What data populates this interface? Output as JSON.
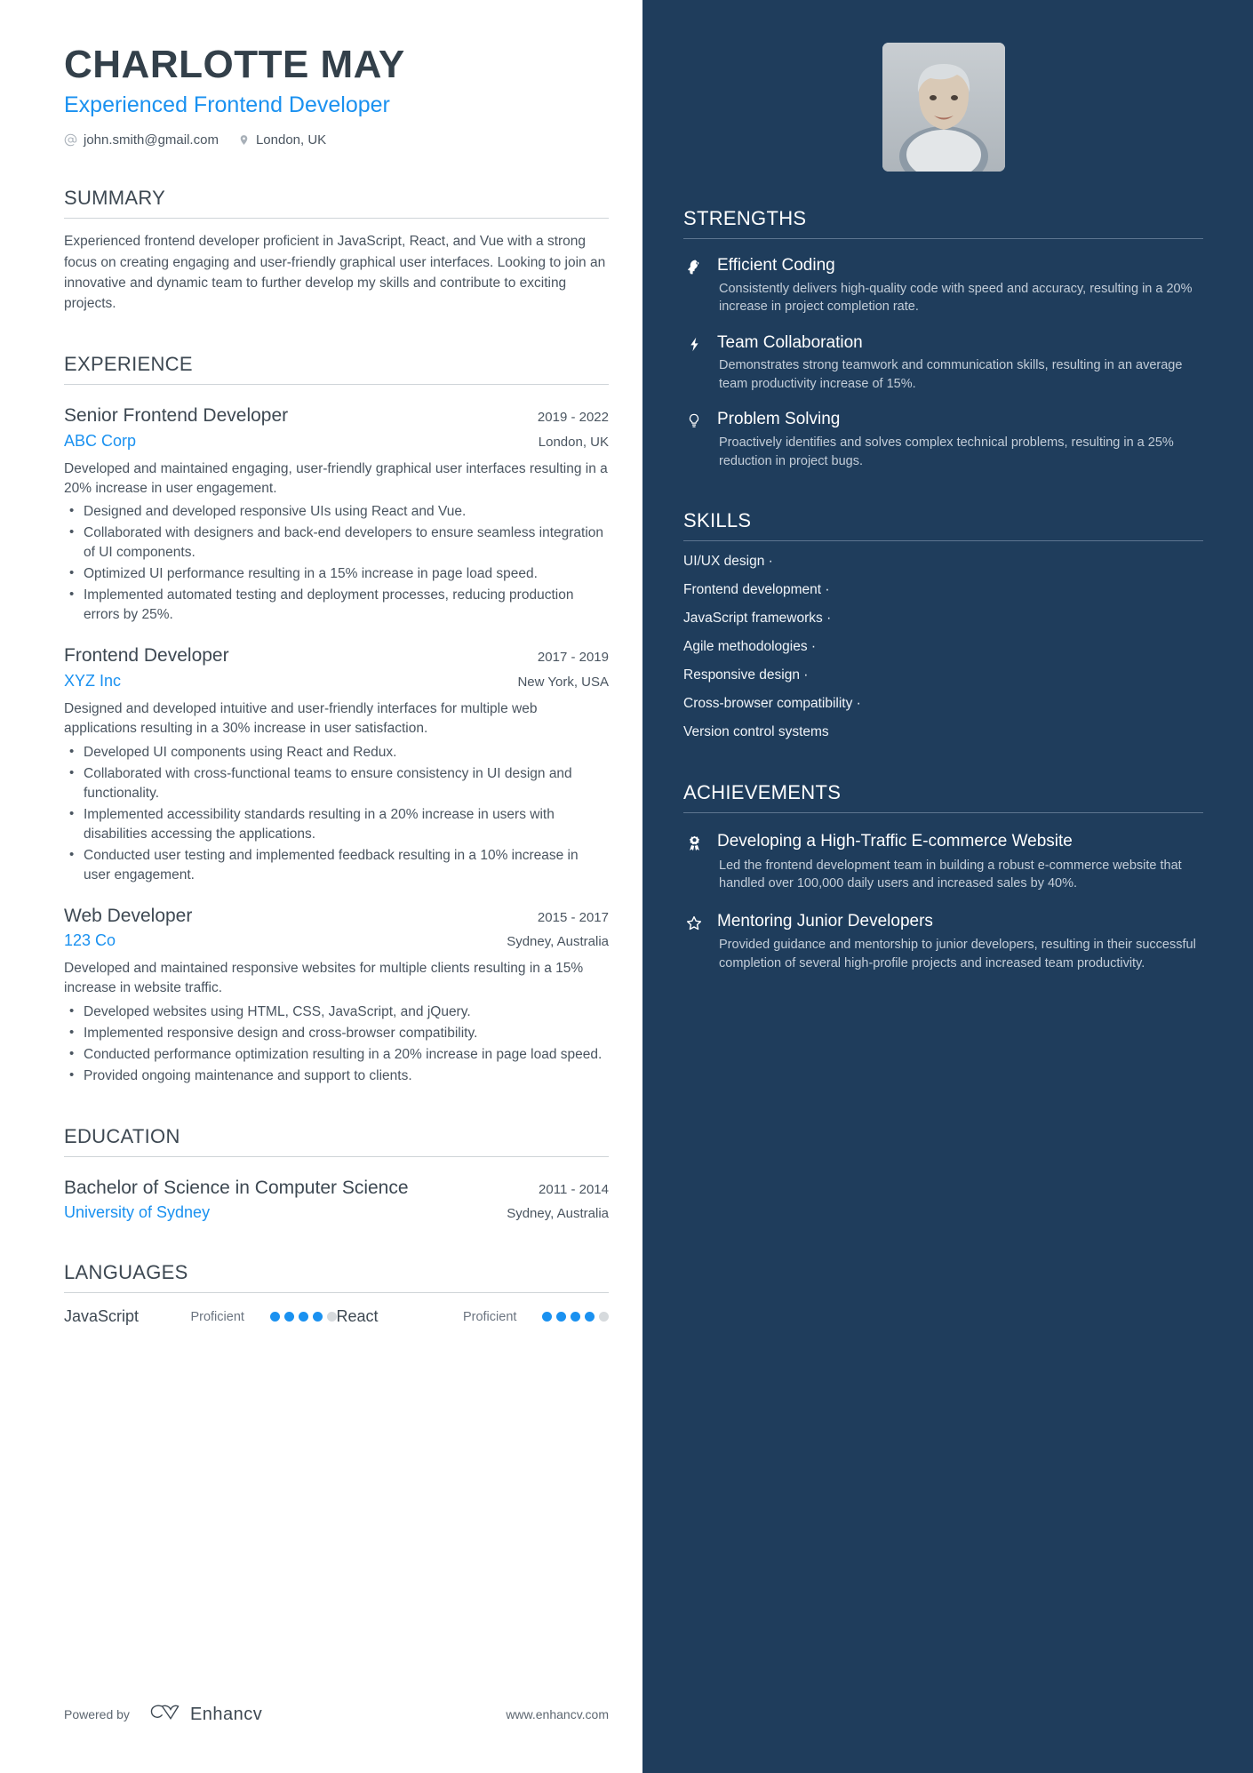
{
  "header": {
    "name": "CHARLOTTE MAY",
    "role": "Experienced Frontend Developer",
    "email": "john.smith@gmail.com",
    "location": "London, UK",
    "email_icon": "at-icon",
    "location_icon": "map-pin-icon"
  },
  "summary": {
    "title": "SUMMARY",
    "text": "Experienced frontend developer proficient in JavaScript, React, and Vue with a strong focus on creating engaging and user-friendly graphical user interfaces. Looking to join an innovative and dynamic team to further develop my skills and contribute to exciting projects."
  },
  "experience": {
    "title": "EXPERIENCE",
    "jobs": [
      {
        "title": "Senior Frontend Developer",
        "date": "2019 - 2022",
        "company": "ABC Corp",
        "location": "London, UK",
        "description": "Developed and maintained engaging, user-friendly graphical user interfaces resulting in a 20% increase in user engagement.",
        "bullets": [
          "Designed and developed responsive UIs using React and Vue.",
          "Collaborated with designers and back-end developers to ensure seamless integration of UI components.",
          "Optimized UI performance resulting in a 15% increase in page load speed.",
          "Implemented automated testing and deployment processes, reducing production errors by 25%."
        ]
      },
      {
        "title": "Frontend Developer",
        "date": "2017 - 2019",
        "company": "XYZ Inc",
        "location": "New York, USA",
        "description": "Designed and developed intuitive and user-friendly interfaces for multiple web applications resulting in a 30% increase in user satisfaction.",
        "bullets": [
          "Developed UI components using React and Redux.",
          "Collaborated with cross-functional teams to ensure consistency in UI design and functionality.",
          "Implemented accessibility standards resulting in a 20% increase in users with disabilities accessing the applications.",
          "Conducted user testing and implemented feedback resulting in a 10% increase in user engagement."
        ]
      },
      {
        "title": "Web Developer",
        "date": "2015 - 2017",
        "company": "123 Co",
        "location": "Sydney, Australia",
        "description": "Developed and maintained responsive websites for multiple clients resulting in a 15% increase in website traffic.",
        "bullets": [
          "Developed websites using HTML, CSS, JavaScript, and jQuery.",
          "Implemented responsive design and cross-browser compatibility.",
          "Conducted performance optimization resulting in a 20% increase in page load speed.",
          "Provided ongoing maintenance and support to clients."
        ]
      }
    ]
  },
  "education": {
    "title": "EDUCATION",
    "entries": [
      {
        "degree": "Bachelor of Science in Computer Science",
        "date": "2011 - 2014",
        "school": "University of Sydney",
        "location": "Sydney, Australia"
      }
    ]
  },
  "languages": {
    "title": "LANGUAGES",
    "items": [
      {
        "name": "JavaScript",
        "level": "Proficient",
        "filled": 4,
        "total": 5
      },
      {
        "name": "React",
        "level": "Proficient",
        "filled": 4,
        "total": 5
      }
    ]
  },
  "footer": {
    "powered_by": "Powered by",
    "brand": "Enhancv",
    "website": "www.enhancv.com",
    "brand_icon": "enhancv-logo-icon"
  },
  "strengths": {
    "title": "STRENGTHS",
    "items": [
      {
        "icon": "head-idea-icon",
        "title": "Efficient Coding",
        "desc": "Consistently delivers high-quality code with speed and accuracy, resulting in a 20% increase in project completion rate."
      },
      {
        "icon": "lightning-bolt-icon",
        "title": "Team Collaboration",
        "desc": "Demonstrates strong teamwork and communication skills, resulting in an average team productivity increase of 15%."
      },
      {
        "icon": "lightbulb-icon",
        "title": "Problem Solving",
        "desc": "Proactively identifies and solves complex technical problems, resulting in a 25% reduction in project bugs."
      }
    ]
  },
  "skills": {
    "title": "SKILLS",
    "items": [
      "UI/UX design ·",
      "Frontend development ·",
      "JavaScript frameworks ·",
      "Agile methodologies ·",
      "Responsive design ·",
      "Cross-browser compatibility ·",
      "Version control systems"
    ]
  },
  "achievements": {
    "title": "ACHIEVEMENTS",
    "items": [
      {
        "icon": "award-medal-icon",
        "title": "Developing a High-Traffic E-commerce Website",
        "desc": "Led the frontend development team in building a robust e-commerce website that handled over 100,000 daily users and increased sales by 40%."
      },
      {
        "icon": "star-outline-icon",
        "title": "Mentoring Junior Developers",
        "desc": "Provided guidance and mentorship to junior developers, resulting in their successful completion of several high-profile projects and increased team productivity."
      }
    ]
  },
  "colors": {
    "accent": "#1a91f0",
    "sidebar_bg": "#1f3d5c",
    "text": "#3d4852"
  }
}
